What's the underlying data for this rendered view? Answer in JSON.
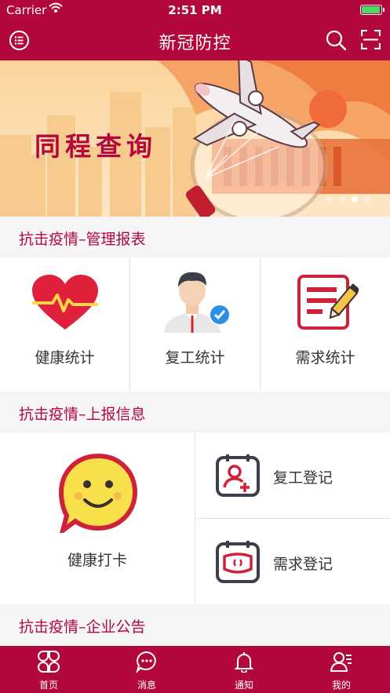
{
  "status_bar": {
    "carrier": "Carrier",
    "time": "2:51 PM",
    "battery_level": 1.0
  },
  "nav": {
    "title": "新冠防控",
    "menu_icon": "list-icon",
    "search_icon": "search-icon",
    "scan_icon": "scan-icon"
  },
  "banner": {
    "text": "同程查询",
    "page_count": 4,
    "active_page": 2
  },
  "sections": {
    "management": {
      "title": "抗击疫情–管理报表",
      "items": [
        {
          "label": "健康统计",
          "icon": "heartbeat-icon"
        },
        {
          "label": "复工统计",
          "icon": "worker-icon"
        },
        {
          "label": "需求统计",
          "icon": "edit-document-icon"
        }
      ]
    },
    "report": {
      "title": "抗击疫情–上报信息",
      "checkin": {
        "label": "健康打卡",
        "icon": "smiley-icon"
      },
      "items": [
        {
          "label": "复工登记",
          "icon": "add-person-calendar-icon"
        },
        {
          "label": "需求登记",
          "icon": "mask-calendar-icon"
        }
      ]
    },
    "notice": {
      "title": "抗击疫情–企业公告"
    }
  },
  "tabbar": {
    "items": [
      {
        "label": "首页",
        "icon": "home-grid-icon"
      },
      {
        "label": "消息",
        "icon": "chat-icon"
      },
      {
        "label": "通知",
        "icon": "bell-icon"
      },
      {
        "label": "我的",
        "icon": "profile-icon"
      }
    ],
    "active": 0
  },
  "colors": {
    "primary": "#b3083d",
    "background": "#f2f2f2"
  }
}
